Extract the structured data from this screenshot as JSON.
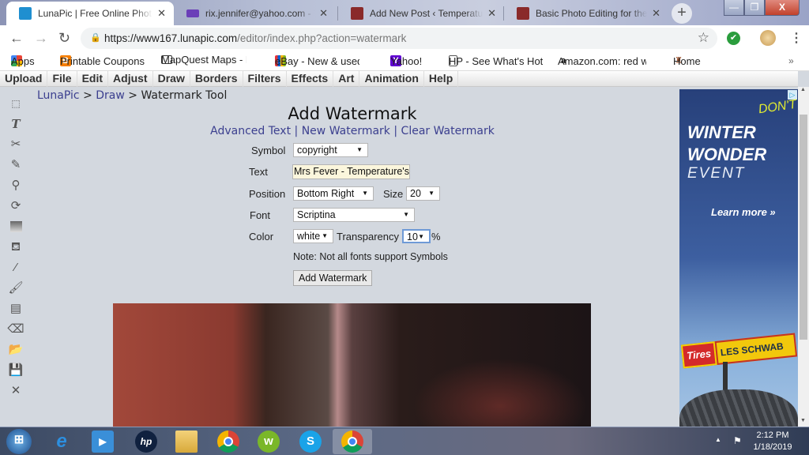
{
  "browser": {
    "tabs": [
      {
        "title": "LunaPic | Free Online Photo Editor",
        "favicon": "lunapic-icon",
        "active": true
      },
      {
        "title": "rix.jennifer@yahoo.com - Yahoo Mail",
        "favicon": "mail-icon",
        "active": false
      },
      {
        "title": "Add New Post ‹ Temperature's",
        "favicon": "photo-thumb-icon",
        "active": false
      },
      {
        "title": "Basic Photo Editing for the Entire",
        "favicon": "photo-thumb-icon",
        "active": false
      }
    ],
    "close_glyph": "✕",
    "new_tab_glyph": "+",
    "window_controls": {
      "minimize": "—",
      "maximize": "❐",
      "close": "X"
    },
    "url_domain": "https://www167.lunapic.com",
    "url_path": "/editor/index.php?action=watermark",
    "bookmarks": [
      {
        "label": "Apps",
        "icon": "apps-grid-icon"
      },
      {
        "label": "Printable Coupons",
        "icon": "blogger-icon"
      },
      {
        "label": "MapQuest Maps - Driving",
        "icon": "map-icon"
      },
      {
        "label": "eBay - New & used electronics",
        "icon": "shopping-bag-icon"
      },
      {
        "label": "Yahoo!",
        "icon": "yahoo-icon"
      },
      {
        "label": "HP - See What's Hot",
        "icon": "page-icon"
      },
      {
        "label": "Amazon.com: red wo",
        "icon": "amazon-icon"
      },
      {
        "label": "Home",
        "icon": "home-figure-icon"
      }
    ],
    "bookmarks_more": "»"
  },
  "lunapic": {
    "menu": [
      "Upload",
      "File",
      "Edit",
      "Adjust",
      "Draw",
      "Borders",
      "Filters",
      "Effects",
      "Art",
      "Animation",
      "Help"
    ],
    "tools": [
      "marquee-select-icon",
      "text-tool-icon",
      "scissors-icon",
      "pencil-icon",
      "magnifier-icon",
      "rotate-icon",
      "gradient-icon",
      "paint-bucket-icon",
      "eyedropper-icon",
      "brush-icon",
      "layers-icon",
      "eraser-icon",
      "open-folder-icon",
      "save-disk-icon",
      "close-x-icon"
    ],
    "breadcrumb": {
      "home": "LunaPic",
      "sep": ">",
      "section": "Draw",
      "current": "Watermark Tool"
    },
    "title": "Add Watermark",
    "links": {
      "advanced_text": "Advanced Text",
      "new_watermark": "New Watermark",
      "clear_watermark": "Clear Watermark",
      "sep": "|"
    },
    "form": {
      "symbol_label": "Symbol",
      "symbol_value": "copyright",
      "text_label": "Text",
      "text_value": "Mrs Fever - Temperature's",
      "position_label": "Position",
      "position_value": "Bottom Right",
      "size_label": "Size",
      "size_value": "20",
      "font_label": "Font",
      "font_value": "Scriptina",
      "color_label": "Color",
      "color_value": "white",
      "transparency_label": "Transparency",
      "transparency_value": "10",
      "transparency_unit": "%",
      "note": "Note: Not all fonts support Symbols",
      "submit_label": "Add Watermark"
    }
  },
  "ad": {
    "headline_1": "WINTER",
    "headline_2": "WONDER",
    "headline_3": "EVENT",
    "scribble": "DON'T",
    "cta": "Learn more »",
    "sign_left": "Tires",
    "sign_right": "LES SCHWAB",
    "adchoices_glyph": "▷"
  },
  "taskbar": {
    "apps": [
      "windows-start-icon",
      "internet-explorer-icon",
      "media-player-icon",
      "hp-icon",
      "file-explorer-icon",
      "chrome-icon",
      "w-app-icon",
      "skype-icon",
      "chrome-active-icon"
    ],
    "time": "2:12 PM",
    "date": "1/18/2019"
  }
}
